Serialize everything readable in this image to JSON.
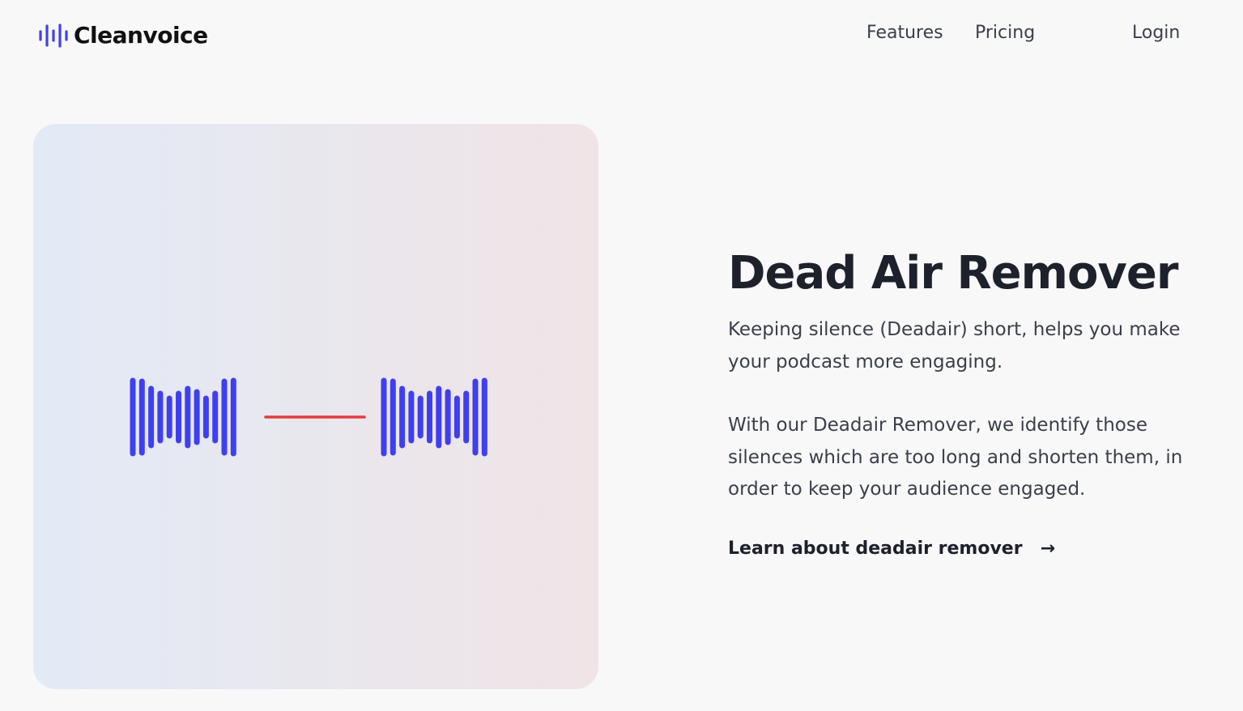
{
  "header": {
    "brand": "Cleanvoice",
    "brand_icon": "soundwave-logo-icon",
    "nav": {
      "features": "Features",
      "pricing": "Pricing",
      "login": "Login"
    }
  },
  "colors": {
    "wave": "#3f3ff2",
    "silence_line": "#e23c3c",
    "text": "#1d212c",
    "muted_text": "#3a3f4b"
  },
  "illustration": {
    "icons": [
      "waveform-icon",
      "silence-line-icon",
      "waveform-icon"
    ]
  },
  "feature": {
    "title": "Dead Air Remover",
    "paragraph1": "Keeping silence (Deadair) short, helps you make your podcast more engaging.",
    "paragraph2": "With our Deadair Remover, we identify those silences which are too long and shorten them, in order to keep your audience engaged.",
    "cta_label": "Learn about deadair remover",
    "cta_icon": "arrow-right-icon"
  }
}
